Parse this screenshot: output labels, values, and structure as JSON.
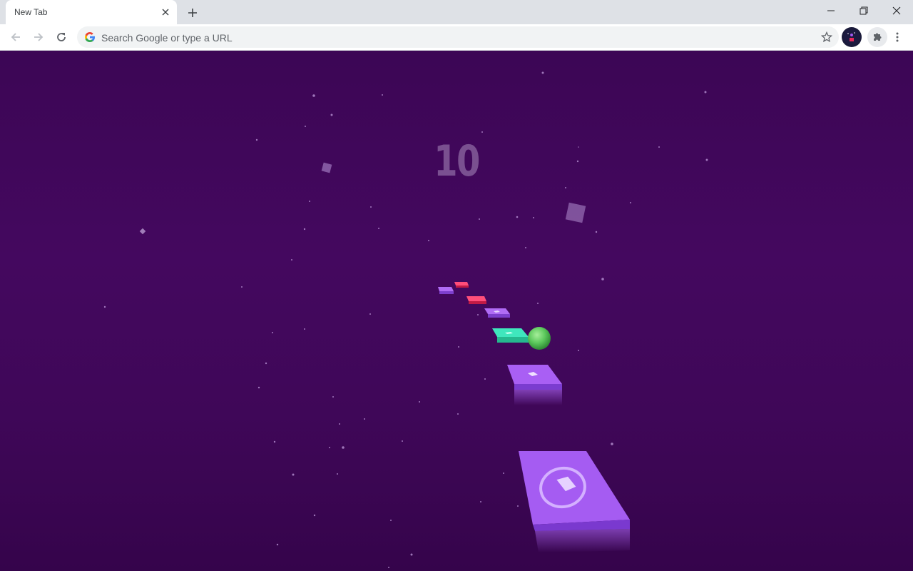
{
  "browser": {
    "tab_title": "New Tab",
    "omnibox_placeholder": "Search Google or type a URL"
  },
  "game": {
    "score": "10",
    "colors": {
      "background_top": "#3c0655",
      "background_bottom": "#35044b",
      "platform_purple": "#a259f0",
      "platform_red": "#e8285a",
      "platform_teal": "#38d9b0",
      "ball_green": "#5cc85c",
      "score_text": "#aa8cbe"
    },
    "icons": [
      "star-icon",
      "profile-avatar-icon",
      "extensions-puzzle-icon",
      "menu-dots-icon"
    ]
  }
}
